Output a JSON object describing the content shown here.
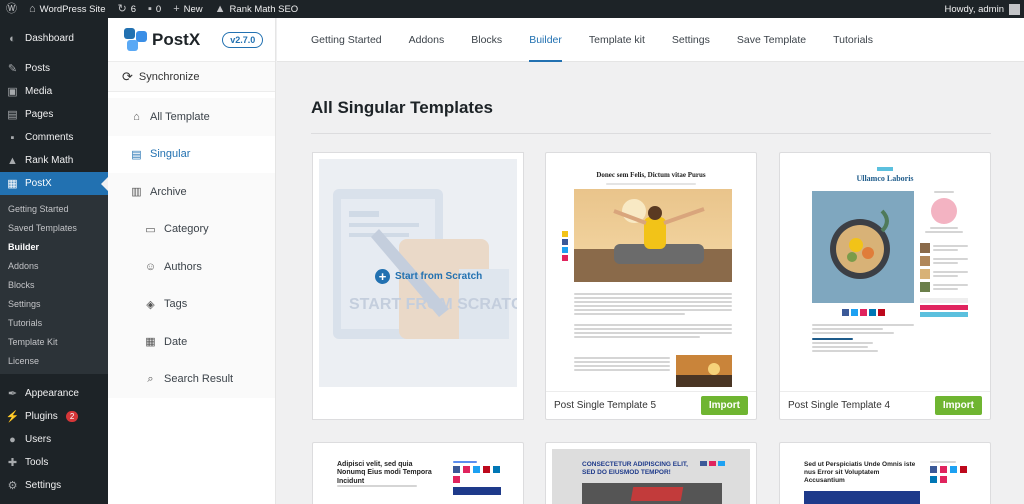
{
  "adminbar": {
    "site": "WordPress Site",
    "updates": "6",
    "comments": "0",
    "new": "New",
    "rankmath": "Rank Math SEO",
    "howdy": "Howdy, admin"
  },
  "wpmenu": {
    "items": [
      "Dashboard",
      "Posts",
      "Media",
      "Pages",
      "Comments",
      "Rank Math",
      "PostX"
    ],
    "submenu": [
      "Getting Started",
      "Saved Templates",
      "Builder",
      "Addons",
      "Blocks",
      "Settings",
      "Tutorials",
      "Template Kit",
      "License"
    ],
    "lower": [
      "Appearance",
      "Plugins",
      "Users",
      "Tools",
      "Settings"
    ],
    "plugins_badge": "2"
  },
  "postx": {
    "brand": "PostX",
    "version": "v2.7.0",
    "sync": "Synchronize",
    "nav": [
      "All Template",
      "Singular",
      "Archive",
      "Category",
      "Authors",
      "Tags",
      "Date",
      "Search Result"
    ]
  },
  "tabs": [
    "Getting Started",
    "Addons",
    "Blocks",
    "Builder",
    "Template kit",
    "Settings",
    "Save Template",
    "Tutorials"
  ],
  "main": {
    "title": "All Singular Templates",
    "scratch_label": "Start from Scratch",
    "scratch_ghost": "START FROM SCRATCH",
    "cards": [
      {
        "name": "Post Single Template 5",
        "import": "Import",
        "headline": "Donec sem Felis, Dictum vitae Purus"
      },
      {
        "name": "Post Single Template 4",
        "import": "Import",
        "headline": "Ullamco Laboris"
      }
    ],
    "row2": [
      {
        "headline": "Adipisci velit, sed quia Nonumq Eius modi Tempora Incidunt"
      },
      {
        "headline": "CONSECTETUR ADIPISCING ELIT, SED DO EIUSMOD TEMPOR!"
      },
      {
        "headline": "Sed ut Perspiciatis Unde Omnis iste nus Error sit Voluptatem Accusantium"
      }
    ]
  },
  "colors": {
    "accent": "#2271b1",
    "import": "#6fb531",
    "adminbar": "#1d2327"
  }
}
